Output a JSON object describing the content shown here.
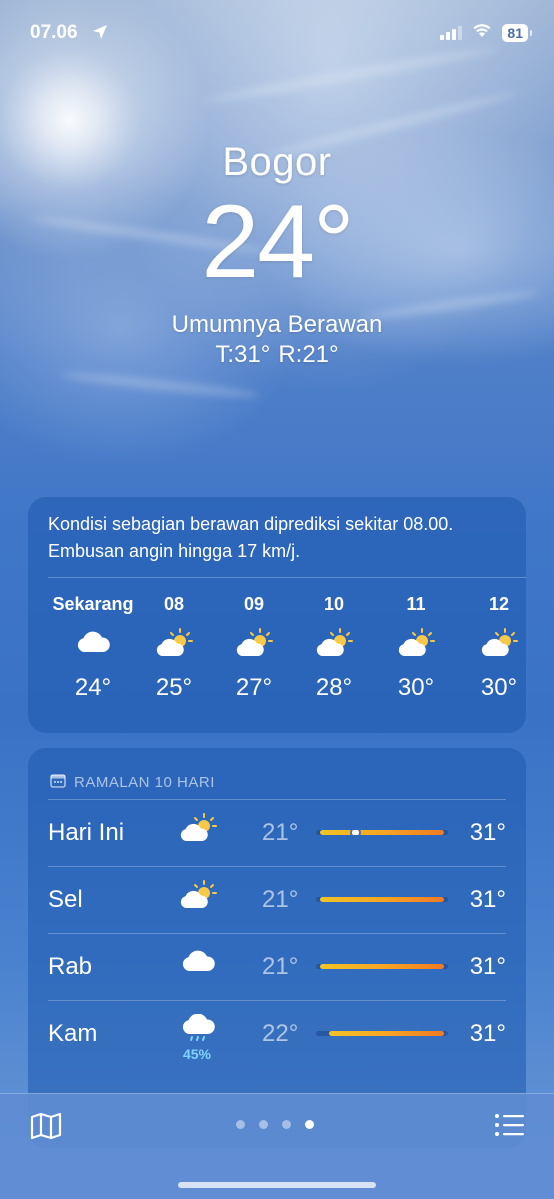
{
  "status": {
    "time": "07.06",
    "battery": "81"
  },
  "current": {
    "city": "Bogor",
    "temperature": "24°",
    "condition": "Umumnya Berawan",
    "high": "T:31°",
    "low": "R:21°"
  },
  "hourly": {
    "summary": "Kondisi sebagian berawan diprediksi sekitar 08.00. Embusan angin hingga 17 km/j.",
    "items": [
      {
        "label": "Sekarang",
        "icon": "cloud-icon",
        "temp": "24°"
      },
      {
        "label": "08",
        "icon": "partly-sunny-icon",
        "temp": "25°"
      },
      {
        "label": "09",
        "icon": "partly-sunny-icon",
        "temp": "27°"
      },
      {
        "label": "10",
        "icon": "partly-sunny-icon",
        "temp": "28°"
      },
      {
        "label": "11",
        "icon": "partly-sunny-icon",
        "temp": "30°"
      },
      {
        "label": "12",
        "icon": "partly-sunny-icon",
        "temp": "30°"
      }
    ]
  },
  "daily": {
    "header": "RAMALAN 10 HARI",
    "range_min": 21,
    "range_max": 31,
    "days": [
      {
        "name": "Hari Ini",
        "icon": "partly-sunny-icon",
        "low": "21°",
        "high": "31°",
        "low_val": 21,
        "high_val": 31,
        "current_val": 24
      },
      {
        "name": "Sel",
        "icon": "partly-sunny-icon",
        "low": "21°",
        "high": "31°",
        "low_val": 21,
        "high_val": 31
      },
      {
        "name": "Rab",
        "icon": "cloud-icon",
        "low": "21°",
        "high": "31°",
        "low_val": 21,
        "high_val": 31
      },
      {
        "name": "Kam",
        "icon": "rain-cloud-icon",
        "precip": "45%",
        "low": "22°",
        "high": "31°",
        "low_val": 22,
        "high_val": 31
      }
    ]
  },
  "colors": {
    "precip": "#7fd3ff",
    "bar_start": "#f2c326",
    "bar_end": "#f07a25"
  }
}
